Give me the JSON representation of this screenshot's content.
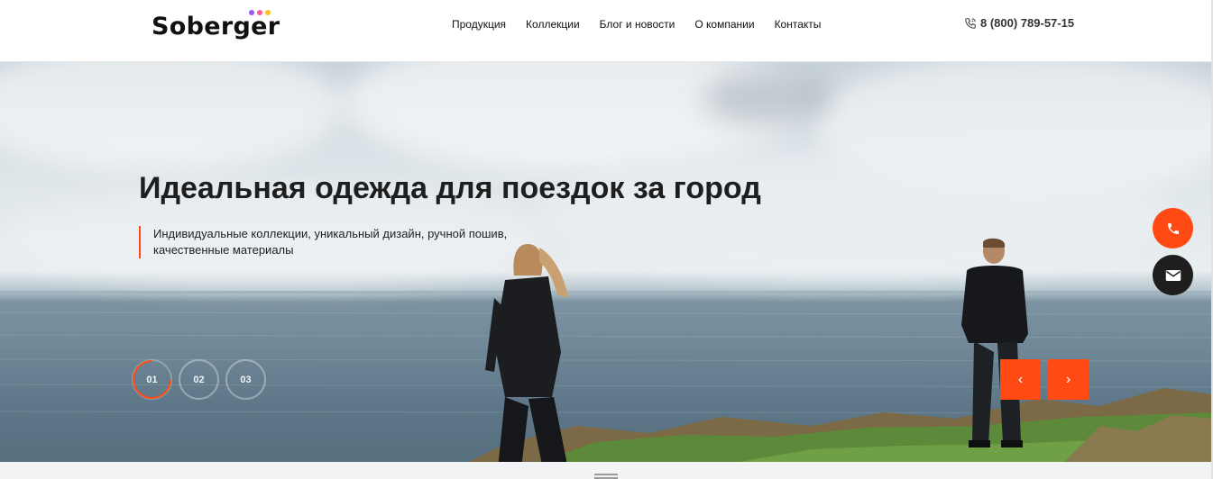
{
  "header": {
    "logo": "Soberger",
    "nav": [
      {
        "label": "Продукция"
      },
      {
        "label": "Коллекции"
      },
      {
        "label": "Блог и новости"
      },
      {
        "label": "О компании"
      },
      {
        "label": "Контакты"
      }
    ],
    "phone": "8 (800) 789-57-15"
  },
  "hero": {
    "title": "Идеальная одежда для поездок за город",
    "subtitle_line1": "Индивидуальные коллекции, уникальный дизайн, ручной пошив,",
    "subtitle_line2": "качественные материалы",
    "slides": [
      {
        "label": "01",
        "active": true
      },
      {
        "label": "02",
        "active": false
      },
      {
        "label": "03",
        "active": false
      }
    ],
    "prev_icon": "chevron-left-icon",
    "next_icon": "chevron-right-icon"
  },
  "fab": {
    "phone_icon": "phone-icon",
    "mail_icon": "mail-icon"
  },
  "colors": {
    "accent": "#ff4a14",
    "dark": "#1e1e1e",
    "logo_dots": [
      "#9b59f0",
      "#ff5aa0",
      "#ffc21a"
    ]
  }
}
